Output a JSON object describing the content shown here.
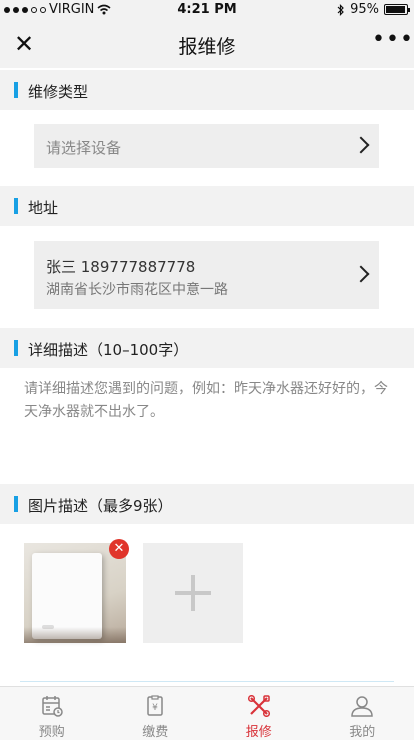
{
  "status_bar": {
    "carrier": "VIRGIN",
    "time": "4:21 PM",
    "battery": "95%"
  },
  "nav": {
    "title": "报维修",
    "close_icon": "close-icon",
    "more_icon": "more-icon"
  },
  "sections": {
    "type_title": "维修类型",
    "address_title": "地址",
    "description_title": "详细描述（10–100字）",
    "photos_title": "图片描述（最多9张）"
  },
  "device": {
    "placeholder": "请选择设备"
  },
  "address": {
    "name_phone": "张三 189777887778",
    "detail": "湖南省长沙市雨花区中意一路"
  },
  "description": {
    "placeholder": "请详细描述您遇到的问题，例如：昨天净水器还好好的，今天净水器就不出水了。"
  },
  "photos": {
    "remove_icon": "close-icon",
    "add_icon": "plus-icon"
  },
  "tabs": [
    {
      "label": "预购",
      "icon": "calendar-icon",
      "active": false
    },
    {
      "label": "缴费",
      "icon": "receipt-yen-icon",
      "active": false
    },
    {
      "label": "报修",
      "icon": "tools-icon",
      "active": true
    },
    {
      "label": "我的",
      "icon": "user-icon",
      "active": false
    }
  ],
  "colors": {
    "accent": "#18a0e4",
    "active_tab": "#d9333a",
    "remove_badge": "#e0352b"
  }
}
